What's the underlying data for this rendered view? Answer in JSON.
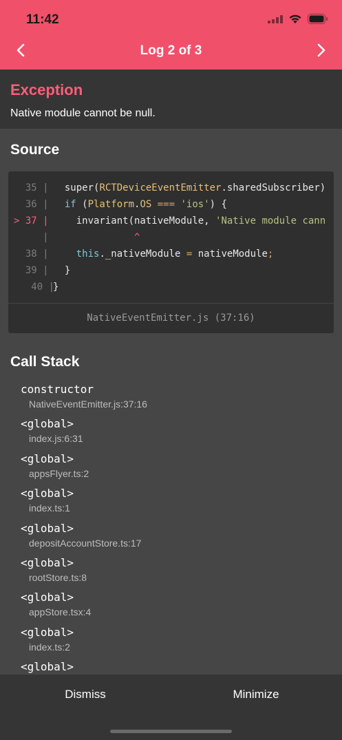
{
  "status_bar": {
    "time": "11:42",
    "icons": [
      "signal-icon",
      "wifi-icon",
      "battery-icon"
    ]
  },
  "nav": {
    "title": "Log 2 of 3",
    "prev_icon": "chevron-left-icon",
    "next_icon": "chevron-right-icon"
  },
  "exception": {
    "title": "Exception",
    "message": "Native module cannot be null."
  },
  "source": {
    "heading": "Source",
    "file_ref": "NativeEventEmitter.js (37:16)"
  },
  "call_stack": {
    "heading": "Call Stack",
    "frames": [
      {
        "fn": "constructor",
        "loc": "NativeEventEmitter.js:37:16"
      },
      {
        "fn": "<global>",
        "loc": "index.js:6:31"
      },
      {
        "fn": "<global>",
        "loc": "appsFlyer.ts:2"
      },
      {
        "fn": "<global>",
        "loc": "index.ts:1"
      },
      {
        "fn": "<global>",
        "loc": "depositAccountStore.ts:17"
      },
      {
        "fn": "<global>",
        "loc": "rootStore.ts:8"
      },
      {
        "fn": "<global>",
        "loc": "appStore.tsx:4"
      },
      {
        "fn": "<global>",
        "loc": "index.ts:2"
      },
      {
        "fn": "<global>",
        "loc": ""
      }
    ]
  },
  "footer": {
    "dismiss_label": "Dismiss",
    "minimize_label": "Minimize"
  },
  "colors": {
    "header_bg": "#f0506a",
    "exception_title": "#ff5e7a",
    "background": "#464646",
    "panel": "#353535",
    "code_bg": "#2f2f2f"
  }
}
